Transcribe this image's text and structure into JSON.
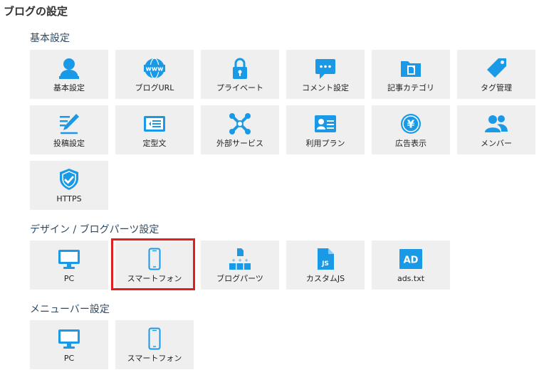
{
  "page_title": "ブログの設定",
  "accent_color": "#1a9ae6",
  "highlight_color": "#e02020",
  "sections": [
    {
      "heading": "基本設定",
      "tiles": [
        {
          "label": "基本設定",
          "icon": "person-icon"
        },
        {
          "label": "ブログURL",
          "icon": "www-globe-icon"
        },
        {
          "label": "プライベート",
          "icon": "lock-icon"
        },
        {
          "label": "コメント設定",
          "icon": "comment-icon"
        },
        {
          "label": "記事カテゴリ",
          "icon": "folder-icon"
        },
        {
          "label": "タグ管理",
          "icon": "tag-icon"
        },
        {
          "label": "投稿設定",
          "icon": "pencil-document-icon"
        },
        {
          "label": "定型文",
          "icon": "template-icon"
        },
        {
          "label": "外部サービス",
          "icon": "link-services-icon"
        },
        {
          "label": "利用プラン",
          "icon": "id-card-icon"
        },
        {
          "label": "広告表示",
          "icon": "yen-icon"
        },
        {
          "label": "メンバー",
          "icon": "members-icon"
        },
        {
          "label": "HTTPS",
          "icon": "shield-check-icon"
        }
      ]
    },
    {
      "heading": "デザイン / ブログパーツ設定",
      "tiles": [
        {
          "label": "PC",
          "icon": "monitor-icon"
        },
        {
          "label": "スマートフォン",
          "icon": "smartphone-icon",
          "highlighted": true
        },
        {
          "label": "ブログパーツ",
          "icon": "blog-parts-icon"
        },
        {
          "label": "カスタムJS",
          "icon": "js-file-icon"
        },
        {
          "label": "ads.txt",
          "icon": "ad-icon",
          "badge": "AD"
        }
      ]
    },
    {
      "heading": "メニューバー設定",
      "tiles": [
        {
          "label": "PC",
          "icon": "monitor-icon"
        },
        {
          "label": "スマートフォン",
          "icon": "smartphone-icon"
        }
      ]
    }
  ]
}
